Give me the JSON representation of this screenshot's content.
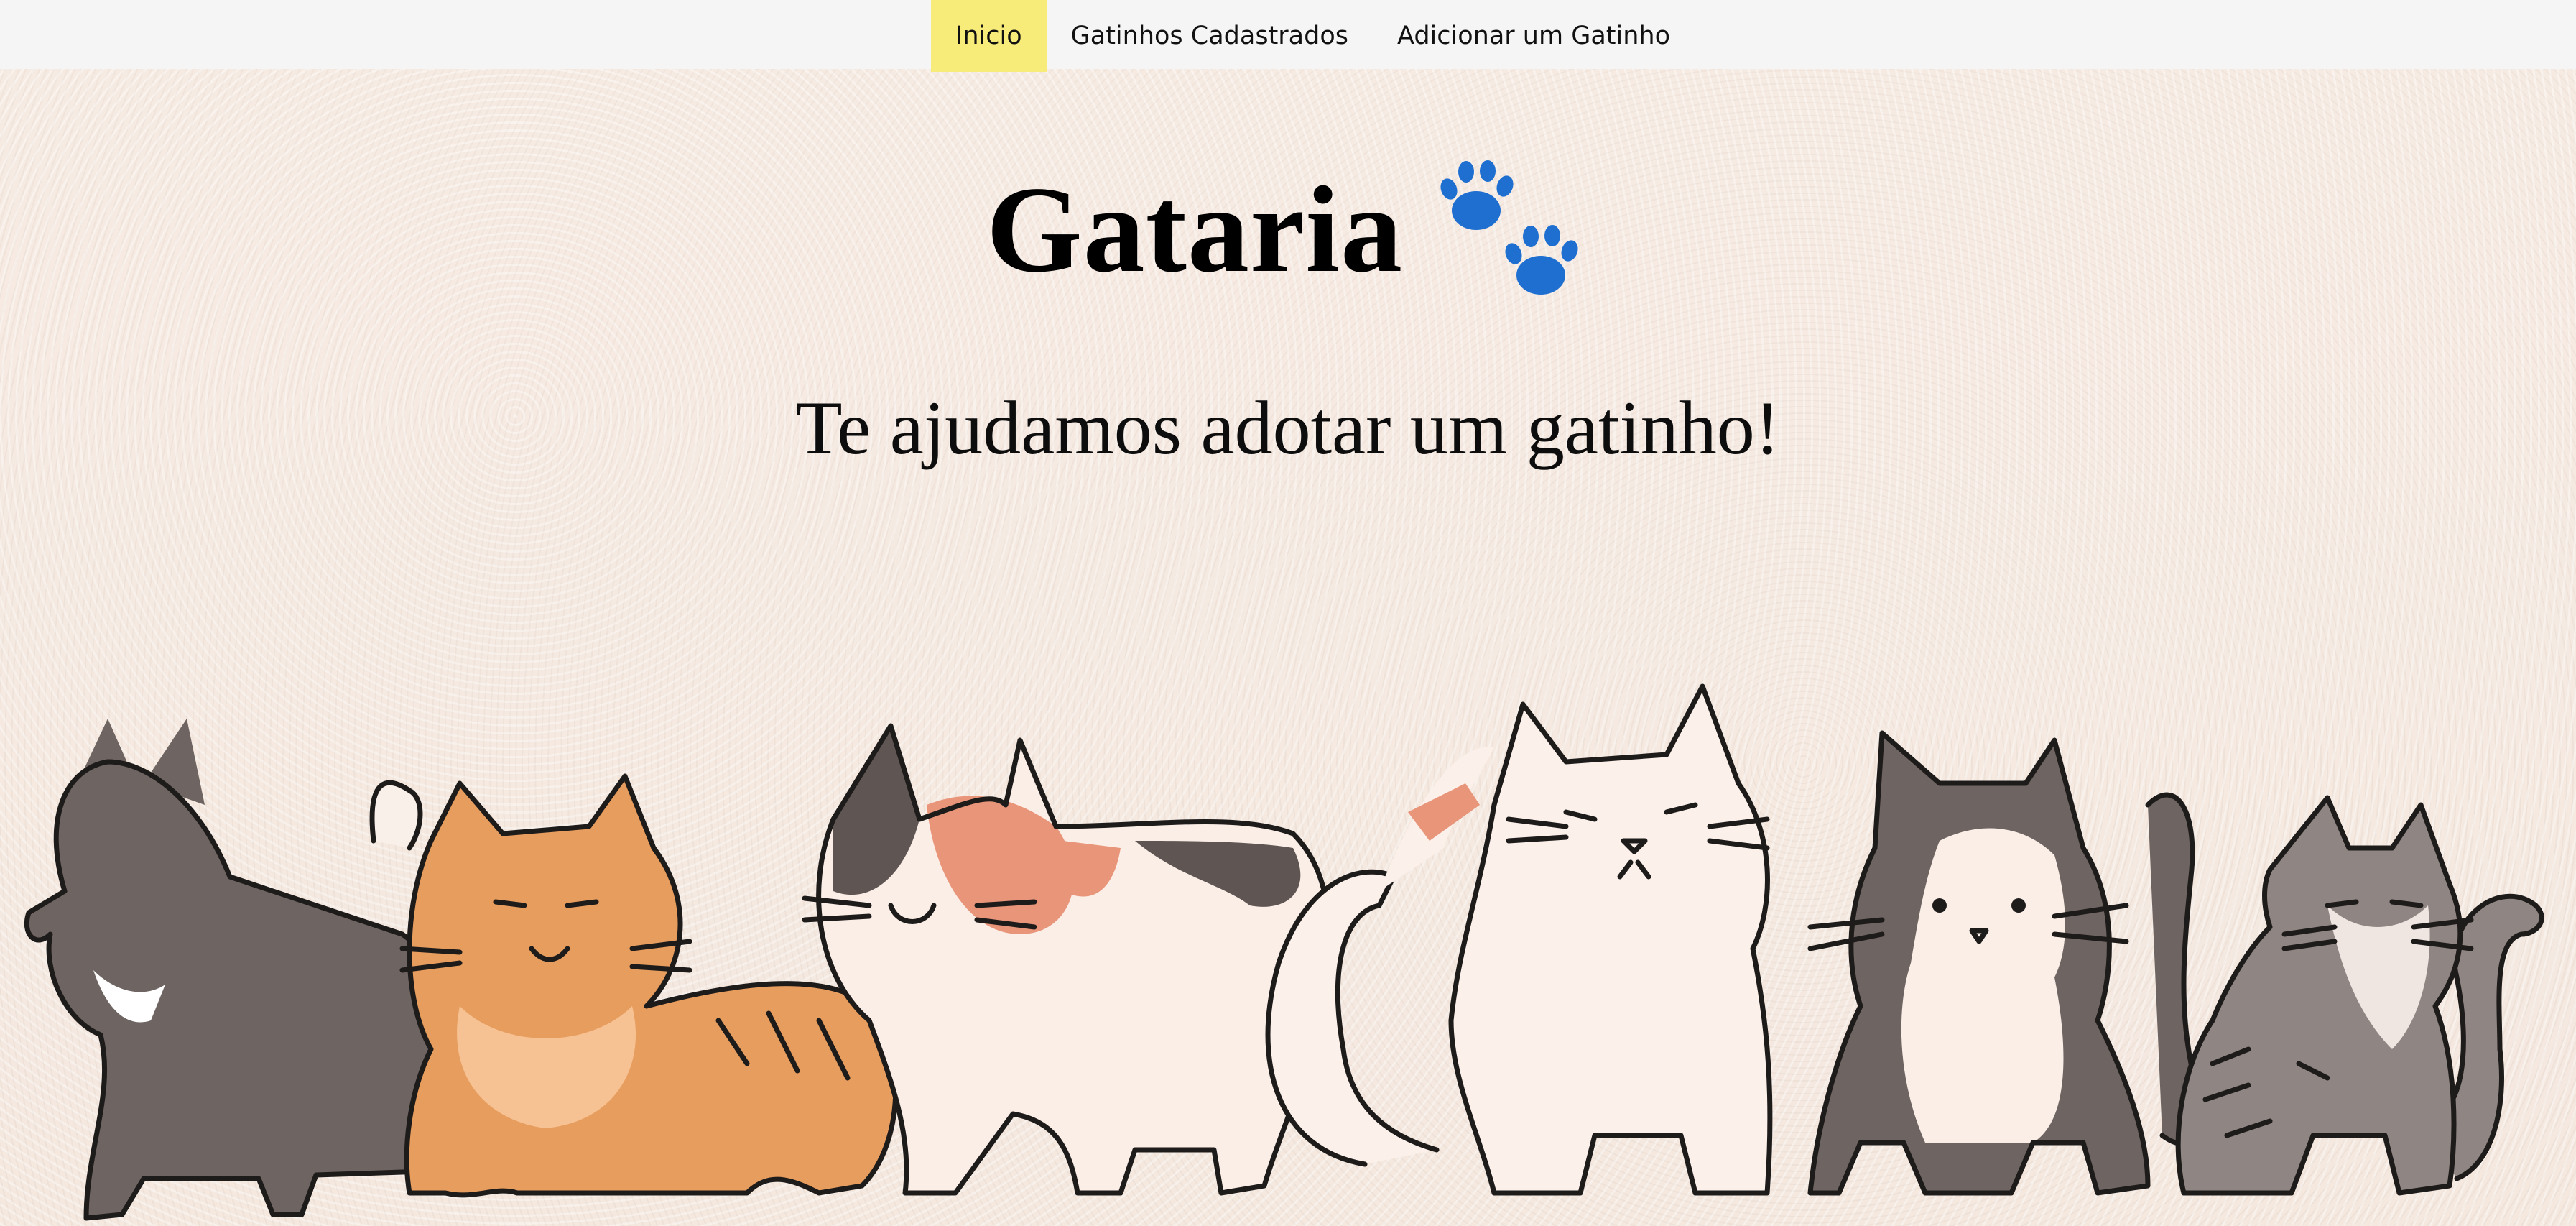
{
  "nav": {
    "items": [
      {
        "label": "Inicio",
        "active": true
      },
      {
        "label": "Gatinhos Cadastrados",
        "active": false
      },
      {
        "label": "Adicionar um Gatinho",
        "active": false
      }
    ],
    "active_color": "#f7ec7a"
  },
  "hero": {
    "title": "Gataria",
    "title_icon": "paw-prints-icon",
    "tagline": "Te ajudamos adotar um gatinho!"
  },
  "illustration": {
    "icon": "cats-illustration",
    "cats": [
      "dark-kitten",
      "orange-tabby-cat",
      "calico-cat",
      "white-cat",
      "tuxedo-cat",
      "grey-tabby-cat"
    ]
  },
  "colors": {
    "nav_background": "#f5f5f5",
    "page_background": "#f7ece4",
    "paw_blue": "#1f6fd1"
  }
}
